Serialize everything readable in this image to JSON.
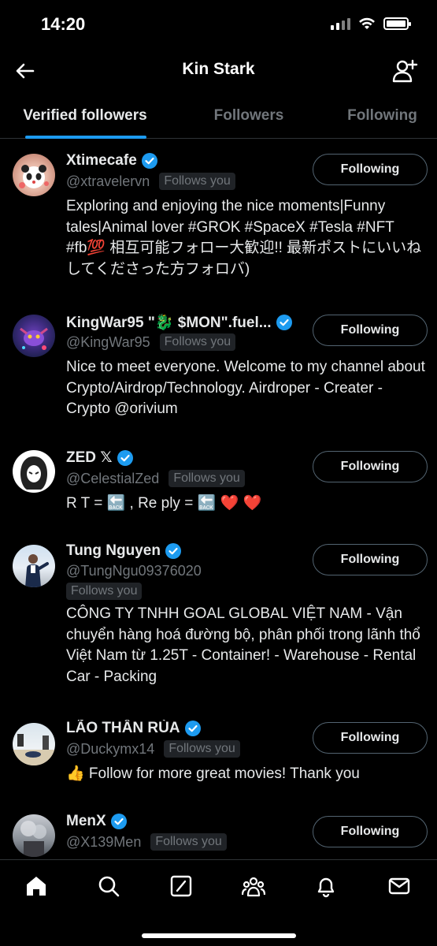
{
  "status": {
    "time": "14:20"
  },
  "header": {
    "title": "Kin Stark"
  },
  "tabs": [
    {
      "label": "Verified followers",
      "active": true
    },
    {
      "label": "Followers",
      "active": false
    },
    {
      "label": "Following",
      "active": false
    }
  ],
  "colors": {
    "accent": "#1d9bf0",
    "background": "#000000",
    "muted": "#71767b"
  },
  "users": [
    {
      "name": "Xtimecafe",
      "handle": "@xtravelervn",
      "follows_you": "Follows you",
      "button": "Following",
      "bio": "Exploring and enjoying the nice moments|Funny tales|Animal lover #GROK #SpaceX #Tesla #NFT #fb💯 相互可能フォロー大歓迎!! 最新ポストにいいねしてくださった方フォロバ)"
    },
    {
      "name": "KingWar95 \"🐉 $MON\".fuel...",
      "handle": "@KingWar95",
      "follows_you": "Follows you",
      "button": "Following",
      "bio": "Nice to meet everyone. Welcome to my channel about Crypto/Airdrop/Technology. Airdroper - Creater - Crypto @orivium"
    },
    {
      "name": "ZED 𝕏",
      "handle": "@CelestialZed",
      "follows_you": "Follows you",
      "button": "Following",
      "bio": "R T = 🔙 , Re ply = 🔙 ❤️ ❤️"
    },
    {
      "name": "Tung Nguyen",
      "handle": "@TungNgu09376020",
      "follows_you": "Follows you",
      "button": "Following",
      "bio": "CÔNG TY TNHH GOAL GLOBAL VIỆT NAM - Vận chuyển hàng hoá đường bộ, phân phối trong lãnh thổ Việt Nam từ 1.25T - Container! - Warehouse - Rental Car - Packing"
    },
    {
      "name": "LÃO THẦN RÙA",
      "handle": "@Duckymx14",
      "follows_you": "Follows you",
      "button": "Following",
      "bio": "👍 Follow for more great movies! Thank you"
    },
    {
      "name": "MenX",
      "handle": "@X139Men",
      "follows_you": "Follows you",
      "button": "Following",
      "bio": ""
    }
  ],
  "nav": [
    "home-icon",
    "search-icon",
    "grok-icon",
    "communities-icon",
    "notifications-icon",
    "messages-icon"
  ]
}
